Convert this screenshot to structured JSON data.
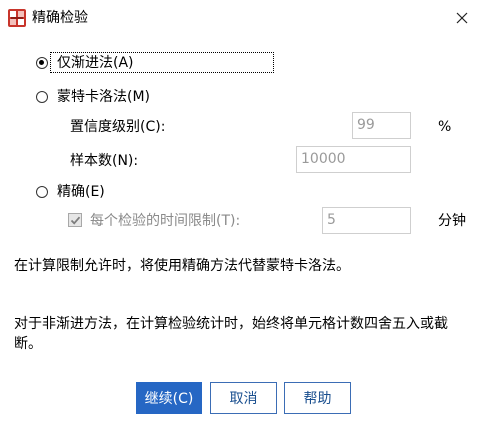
{
  "window": {
    "title": "精确检验"
  },
  "options": {
    "asymptotic": {
      "label": "仅渐进法(A)",
      "checked": true
    },
    "monte_carlo": {
      "label": "蒙特卡洛法(M)",
      "checked": false
    },
    "exact": {
      "label": "精确(E)",
      "checked": false
    }
  },
  "monte_carlo_fields": {
    "confidence_label": "置信度级别(C):",
    "confidence_value": "99",
    "confidence_unit": "%",
    "samples_label": "样本数(N):",
    "samples_value": "10000"
  },
  "exact_fields": {
    "time_limit_label": "每个检验的时间限制(T):",
    "time_limit_checked": true,
    "time_limit_value": "5",
    "time_limit_unit": "分钟"
  },
  "info": {
    "line1": "在计算限制允许时，将使用精确方法代替蒙特卡洛法。",
    "line2": "对于非渐进方法，在计算检验统计时，始终将单元格计数四舍五入或截断。"
  },
  "buttons": {
    "continue": "继续(C)",
    "cancel": "取消",
    "help": "帮助"
  }
}
